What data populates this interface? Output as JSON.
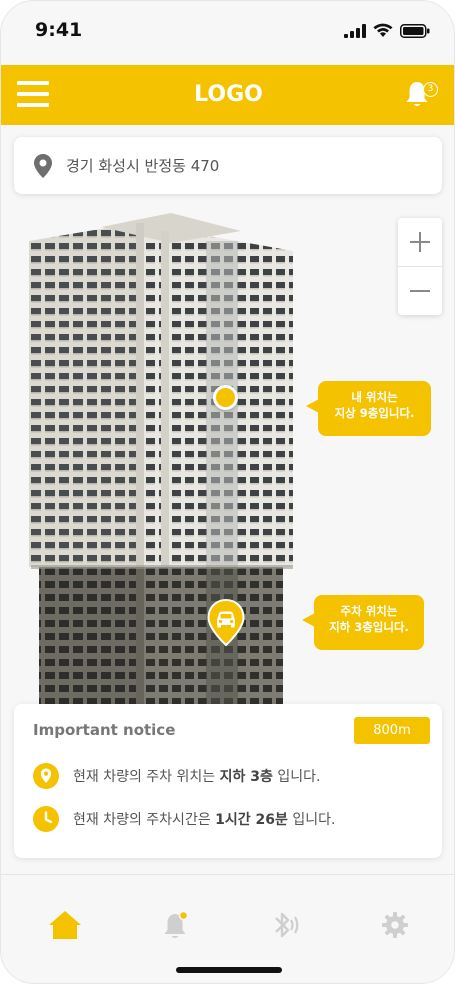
{
  "status_bar": {
    "time": "9:41"
  },
  "header": {
    "logo": "LOGO",
    "notification_count": "3"
  },
  "address": {
    "text": "경기 화성시 반정동 470"
  },
  "map": {
    "my_location_bubble": {
      "line1": "내 위치는",
      "line2": "지상 9층입니다."
    },
    "parking_bubble": {
      "line1": "주차 위치는",
      "line2": "지하 3층입니다."
    }
  },
  "notice": {
    "title": "Important notice",
    "distance": "800m",
    "row1": {
      "prefix": "현재 차량의 주차 위치는 ",
      "bold": "지하 3층",
      "suffix": " 입니다."
    },
    "row2": {
      "prefix": "현재 차량의 주차시간은 ",
      "bold": "1시간 26분",
      "suffix": " 입니다."
    }
  },
  "colors": {
    "accent": "#f5c200",
    "inactive_icon": "#cfcfcf"
  },
  "tabbar": {
    "items": [
      "home-icon",
      "bell-icon",
      "bluetooth-icon",
      "gear-icon"
    ],
    "active": "home-icon"
  }
}
